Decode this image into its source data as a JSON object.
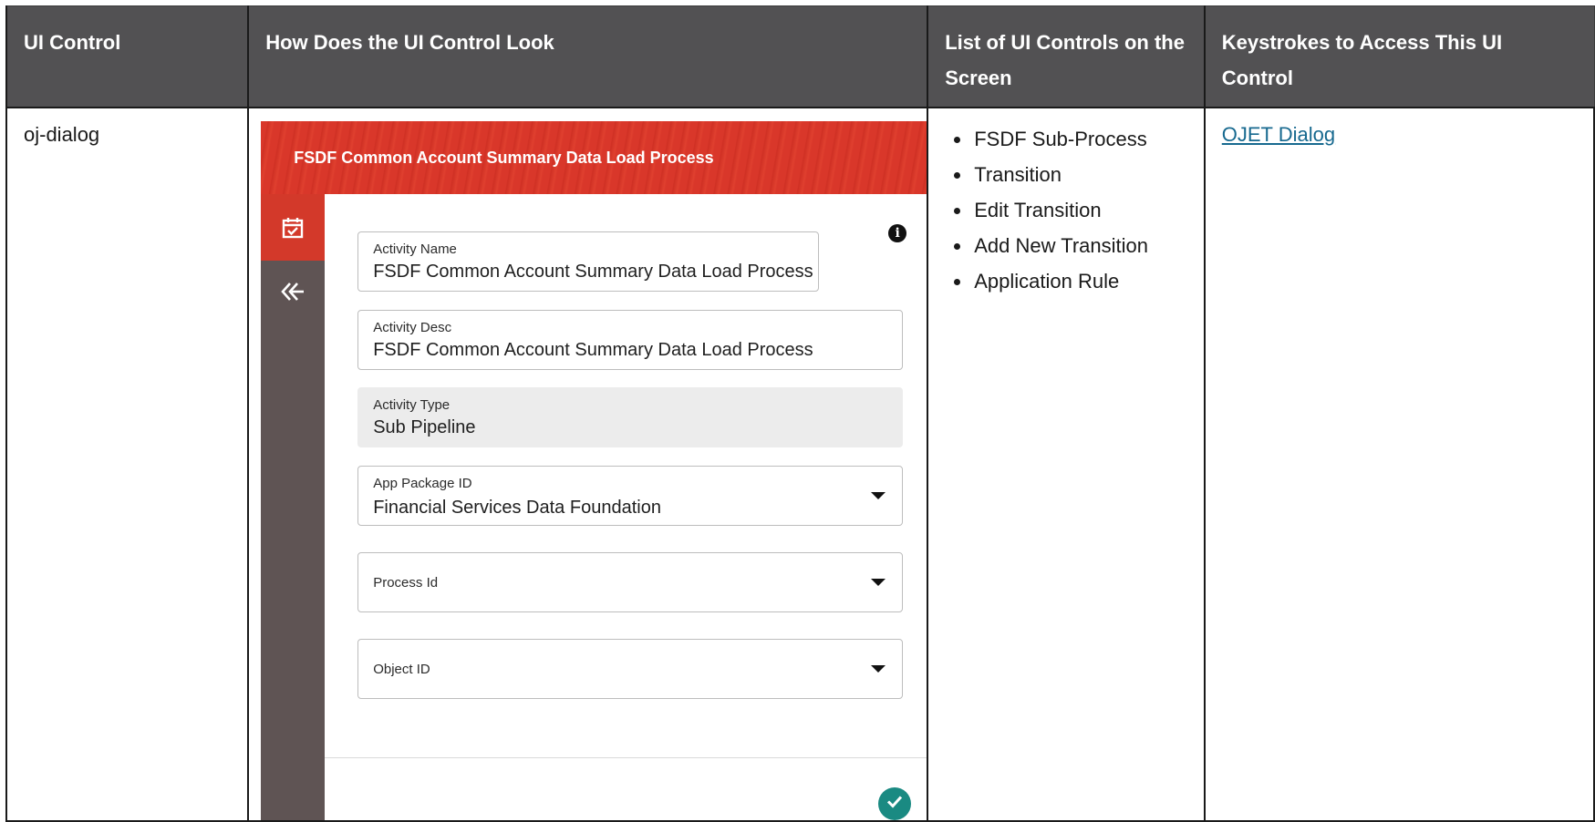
{
  "table": {
    "headers": [
      "UI Control",
      "How Does the UI Control Look",
      "List of UI Controls on the Screen",
      "Keystrokes to Access This UI Control"
    ],
    "row": {
      "control": "oj-dialog",
      "controls_list": [
        "FSDF Sub-Process",
        "Transition",
        "Edit Transition",
        "Add New Transition",
        "Application Rule"
      ],
      "keystroke_link": "OJET Dialog"
    }
  },
  "dialog": {
    "title": "FSDF Common Account Summary Data Load Process",
    "fields": {
      "activity_name": {
        "label": "Activity Name",
        "value": "FSDF Common Account Summary Data Load Process"
      },
      "activity_desc": {
        "label": "Activity Desc",
        "value": "FSDF Common Account Summary Data Load Process"
      },
      "activity_type": {
        "label": "Activity Type",
        "value": "Sub Pipeline"
      },
      "app_package_id": {
        "label": "App Package ID",
        "value": "Financial Services Data Foundation"
      },
      "process_id": {
        "label": "Process Id"
      },
      "object_id": {
        "label": "Object ID"
      }
    },
    "icons": {
      "sidebar_active": "calendar-check-icon",
      "sidebar_collapse": "double-chevron-left-icon",
      "info": "info-icon",
      "submit": "check-circle-icon"
    },
    "colors": {
      "header": "#d9372a",
      "sidebar": "#5f5454",
      "submit": "#1a8a82",
      "link": "#17698f",
      "table_header": "#525153"
    }
  }
}
